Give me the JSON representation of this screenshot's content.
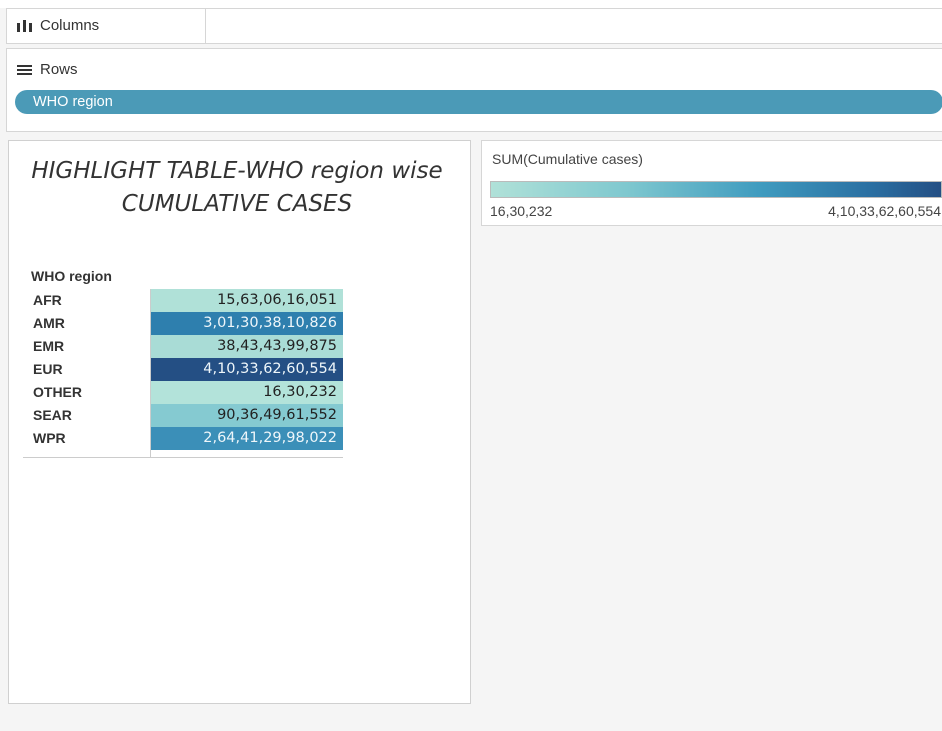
{
  "shelves": {
    "columns_label": "Columns",
    "rows_label": "Rows",
    "rows_pill": "WHO region"
  },
  "sheet": {
    "title": "HIGHLIGHT TABLE-WHO region wise CUMULATIVE CASES",
    "row_header": "WHO region",
    "rows": [
      {
        "region": "AFR",
        "value": "15,63,06,16,051",
        "bg": "#b0e1d8",
        "fg": "#222222"
      },
      {
        "region": "AMR",
        "value": "3,01,30,38,10,826",
        "bg": "#2e7fae",
        "fg": "#eef6fa"
      },
      {
        "region": "EMR",
        "value": "38,43,43,99,875",
        "bg": "#a9dcd6",
        "fg": "#222222"
      },
      {
        "region": "EUR",
        "value": "4,10,33,62,60,554",
        "bg": "#244f84",
        "fg": "#eef6fa"
      },
      {
        "region": "OTHER",
        "value": "16,30,232",
        "bg": "#b3e3da",
        "fg": "#222222"
      },
      {
        "region": "SEAR",
        "value": "90,36,49,61,552",
        "bg": "#85cad1",
        "fg": "#222222"
      },
      {
        "region": "WPR",
        "value": "2,64,41,29,98,022",
        "bg": "#3b8fb8",
        "fg": "#eef6fa"
      }
    ]
  },
  "legend": {
    "title": "SUM(Cumulative cases)",
    "min_label": "16,30,232",
    "max_label": "4,10,33,62,60,554",
    "colors": [
      "#b0e1d8",
      "#244f84"
    ]
  }
}
